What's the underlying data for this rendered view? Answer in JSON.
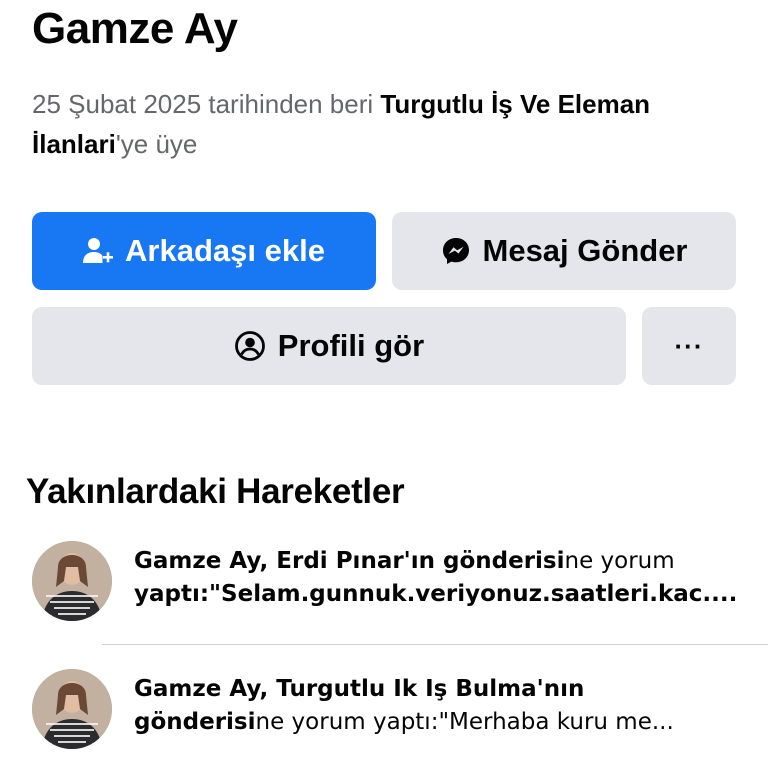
{
  "profile": {
    "name": "Gamze Ay",
    "member_prefix": "25 Şubat 2025 tarihinden beri ",
    "group_name": "Turgutlu İş Ve Eleman İlanlari",
    "member_suffix": "'ye üye"
  },
  "actions": {
    "add_friend_label": "Arkadaşı ekle",
    "message_label": "Mesaj Gönder",
    "view_profile_label": "Profili gör",
    "more_label": "···"
  },
  "recent_activity": {
    "title": "Yakınlardaki Hareketler",
    "items": [
      {
        "actor": "Gamze Ay",
        "target": ", Erdi Pınar'ın gönderisi",
        "action": "ne  yorum",
        "line2_bold": "yaptı:\"Selam.gunnuk.veriyonuz.saatleri.kac....",
        "line2_rest": ""
      },
      {
        "actor": "Gamze Ay",
        "target": ", Turgutlu Ik Iş Bulma'nın",
        "action": "",
        "line2_bold": "gönderisi",
        "line2_rest": "ne  yorum yaptı:\"Merhaba kuru me..."
      }
    ]
  },
  "colors": {
    "primary": "#1877f2",
    "secondary_button": "#e4e6eb",
    "text_primary": "#050505",
    "text_secondary": "#65676b"
  },
  "icons": {
    "add_friend": "person-plus-icon",
    "message": "messenger-icon",
    "profile": "person-circle-icon",
    "more": "ellipsis-icon"
  }
}
